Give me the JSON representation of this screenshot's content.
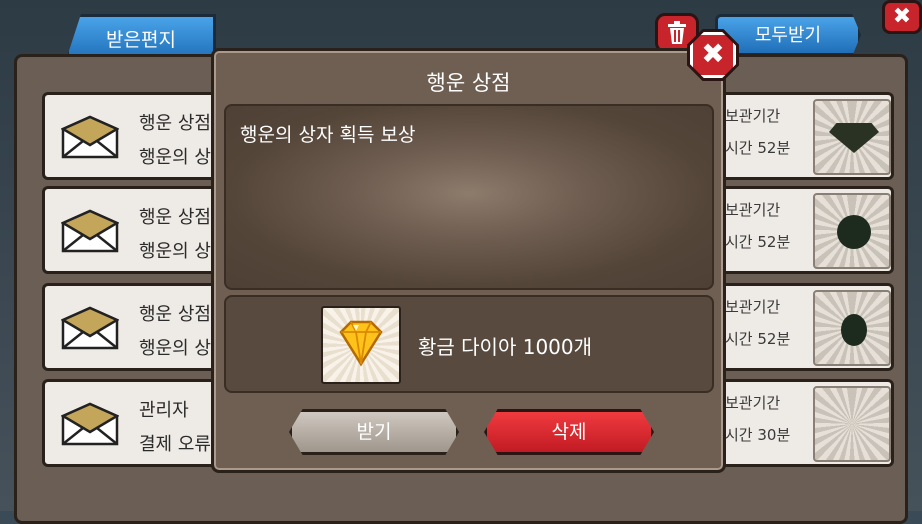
{
  "colors": {
    "accent_blue": "#2e86d6",
    "delete_red": "#d1262d",
    "panel_brown": "#6e5f52"
  },
  "header": {
    "tab_label": "받은편지",
    "receive_all_label": "모두받기",
    "trash_icon": "trash-icon",
    "close_icon": "close-icon"
  },
  "mail_list": [
    {
      "title": "행운 상점",
      "subtitle": "행운의 상",
      "expire_label": "보관기간",
      "expire_value": "시간 52분",
      "item_icon": "dark-diamond-icon"
    },
    {
      "title": "행운 상점",
      "subtitle": "행운의 상",
      "expire_label": "보관기간",
      "expire_value": "시간 52분",
      "item_icon": "dark-gem-icon"
    },
    {
      "title": "행운 상점",
      "subtitle": "행운의 상",
      "expire_label": "보관기간",
      "expire_value": "시간 52분",
      "item_icon": "dark-ore-icon"
    },
    {
      "title": "관리자",
      "subtitle": "결제 오류",
      "expire_label": "보관기간",
      "expire_value": "시간 30분",
      "item_icon": "empty-icon"
    }
  ],
  "modal": {
    "title": "행운 상점",
    "message": "행운의 상자 획득 보상",
    "reward_label": "황금 다이아 1000개",
    "reward_icon": "gold-diamond-icon",
    "accept_label": "받기",
    "delete_label": "삭제",
    "close_glyph": "✖"
  }
}
